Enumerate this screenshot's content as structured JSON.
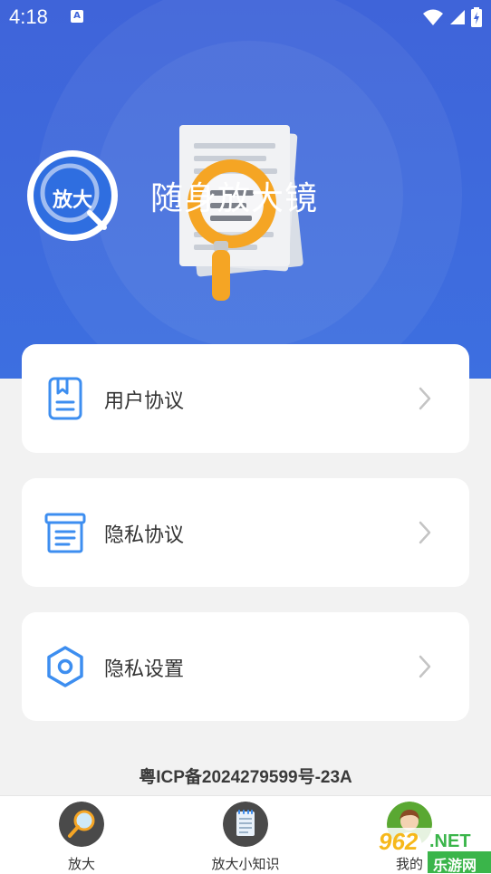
{
  "status_bar": {
    "time": "4:18",
    "notification_icon": "a-icon",
    "icons": [
      "wifi-icon",
      "signal-icon",
      "battery-charging-icon"
    ]
  },
  "header": {
    "logo_text": "放大",
    "app_title": "随身放大镜"
  },
  "menu": [
    {
      "label": "用户协议",
      "icon": "bookmark-document-icon"
    },
    {
      "label": "隐私协议",
      "icon": "archive-document-icon"
    },
    {
      "label": "隐私设置",
      "icon": "hexagon-settings-icon"
    }
  ],
  "footer": {
    "icp": "粤ICP备2024279599号-23A"
  },
  "tabs": [
    {
      "label": "放大",
      "icon": "magnifier-icon"
    },
    {
      "label": "放大小知识",
      "icon": "notepad-icon"
    },
    {
      "label": "我的",
      "icon": "avatar-icon"
    }
  ],
  "watermark": {
    "number": "962",
    "suffix": ".NET",
    "site": "乐游网"
  },
  "colors": {
    "header_blue": "#3f64d9",
    "icon_blue": "#3d8ef0",
    "magnifier_orange": "#f5a524",
    "watermark_green": "#3ab54a",
    "watermark_yellow": "#f6b81b"
  }
}
